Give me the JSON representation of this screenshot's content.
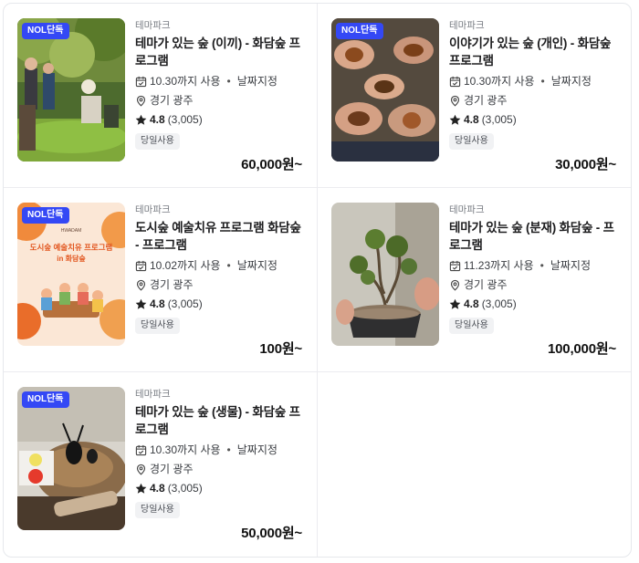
{
  "products": [
    {
      "badge": "NOL단독",
      "category": "테마파크",
      "title": "테마가 있는 숲 (이끼) - 화담숲 프로그램",
      "date_text": "10.30까지 사용",
      "date_type": "날짜지정",
      "location": "경기 광주",
      "rating": "4.8",
      "review_count": "(3,005)",
      "tag": "당일사용",
      "price": "60,000원~"
    },
    {
      "badge": "NOL단독",
      "category": "테마파크",
      "title": "이야기가 있는 숲 (개인) - 화담숲 프로그램",
      "date_text": "10.30까지 사용",
      "date_type": "날짜지정",
      "location": "경기 광주",
      "rating": "4.8",
      "review_count": "(3,005)",
      "tag": "당일사용",
      "price": "30,000원~"
    },
    {
      "badge": "NOL단독",
      "category": "테마파크",
      "title": "도시숲 예술치유 프로그램 화담숲 - 프로그램",
      "date_text": "10.02까지 사용",
      "date_type": "날짜지정",
      "location": "경기 광주",
      "rating": "4.8",
      "review_count": "(3,005)",
      "tag": "당일사용",
      "price": "100원~",
      "poster": {
        "brand": "HWADAM",
        "line1": "도시숲 예술치유 프로그램",
        "line2": "in 화담숲"
      }
    },
    {
      "badge": "",
      "category": "테마파크",
      "title": "테마가 있는 숲 (분재) 화담숲 - 프로그램",
      "date_text": "11.23까지 사용",
      "date_type": "날짜지정",
      "location": "경기 광주",
      "rating": "4.8",
      "review_count": "(3,005)",
      "tag": "당일사용",
      "price": "100,000원~"
    },
    {
      "badge": "NOL단독",
      "category": "테마파크",
      "title": "테마가 있는 숲 (생물) - 화담숲 프로그램",
      "date_text": "10.30까지 사용",
      "date_type": "날짜지정",
      "location": "경기 광주",
      "rating": "4.8",
      "review_count": "(3,005)",
      "tag": "당일사용",
      "price": "50,000원~"
    }
  ],
  "icons": {
    "date": "calendar-icon",
    "location": "location-pin-icon",
    "rating": "star-icon"
  },
  "colors": {
    "badge": "#3448f5",
    "text": "#1c1c1e",
    "muted": "#777b82",
    "tag_bg": "#f1f2f4"
  }
}
